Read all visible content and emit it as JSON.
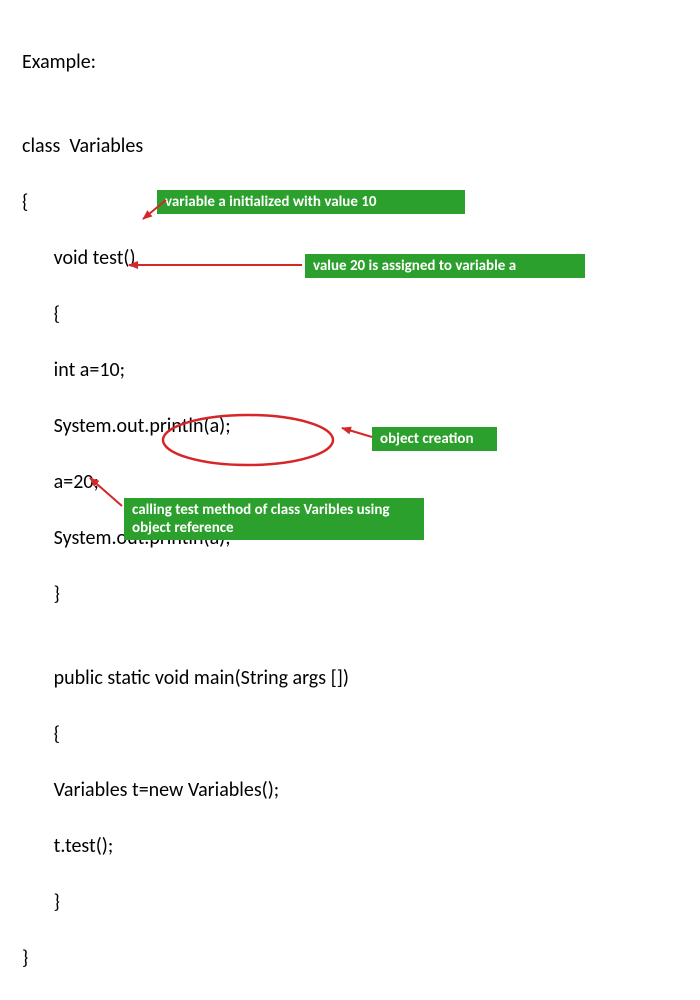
{
  "code": {
    "l1": "Example:",
    "l2": "",
    "l3": "class  Variables",
    "l4": "{",
    "l5": "       void test()",
    "l6": "       {",
    "l7": "       int a=10;",
    "l8": "       System.out.println(a);",
    "l9": "       a=20;",
    "l10": "       System.out.println(a);",
    "l11": "       }",
    "l12": "",
    "l13": "       public static void main(String args [])",
    "l14": "       {",
    "l15": "       Variables t=new Variables();",
    "l16": "       t.test();",
    "l17": "       }",
    "l18": "}"
  },
  "callouts": {
    "c1": "variable a initialized with value 10",
    "c2": "value 20 is assigned to variable a",
    "c3": "object creation",
    "c4": "calling test method of class Varibles using object reference"
  },
  "colors": {
    "callout_bg": "#2ca02c",
    "callout_fg": "#ffffff",
    "arrow": "#d62728"
  }
}
